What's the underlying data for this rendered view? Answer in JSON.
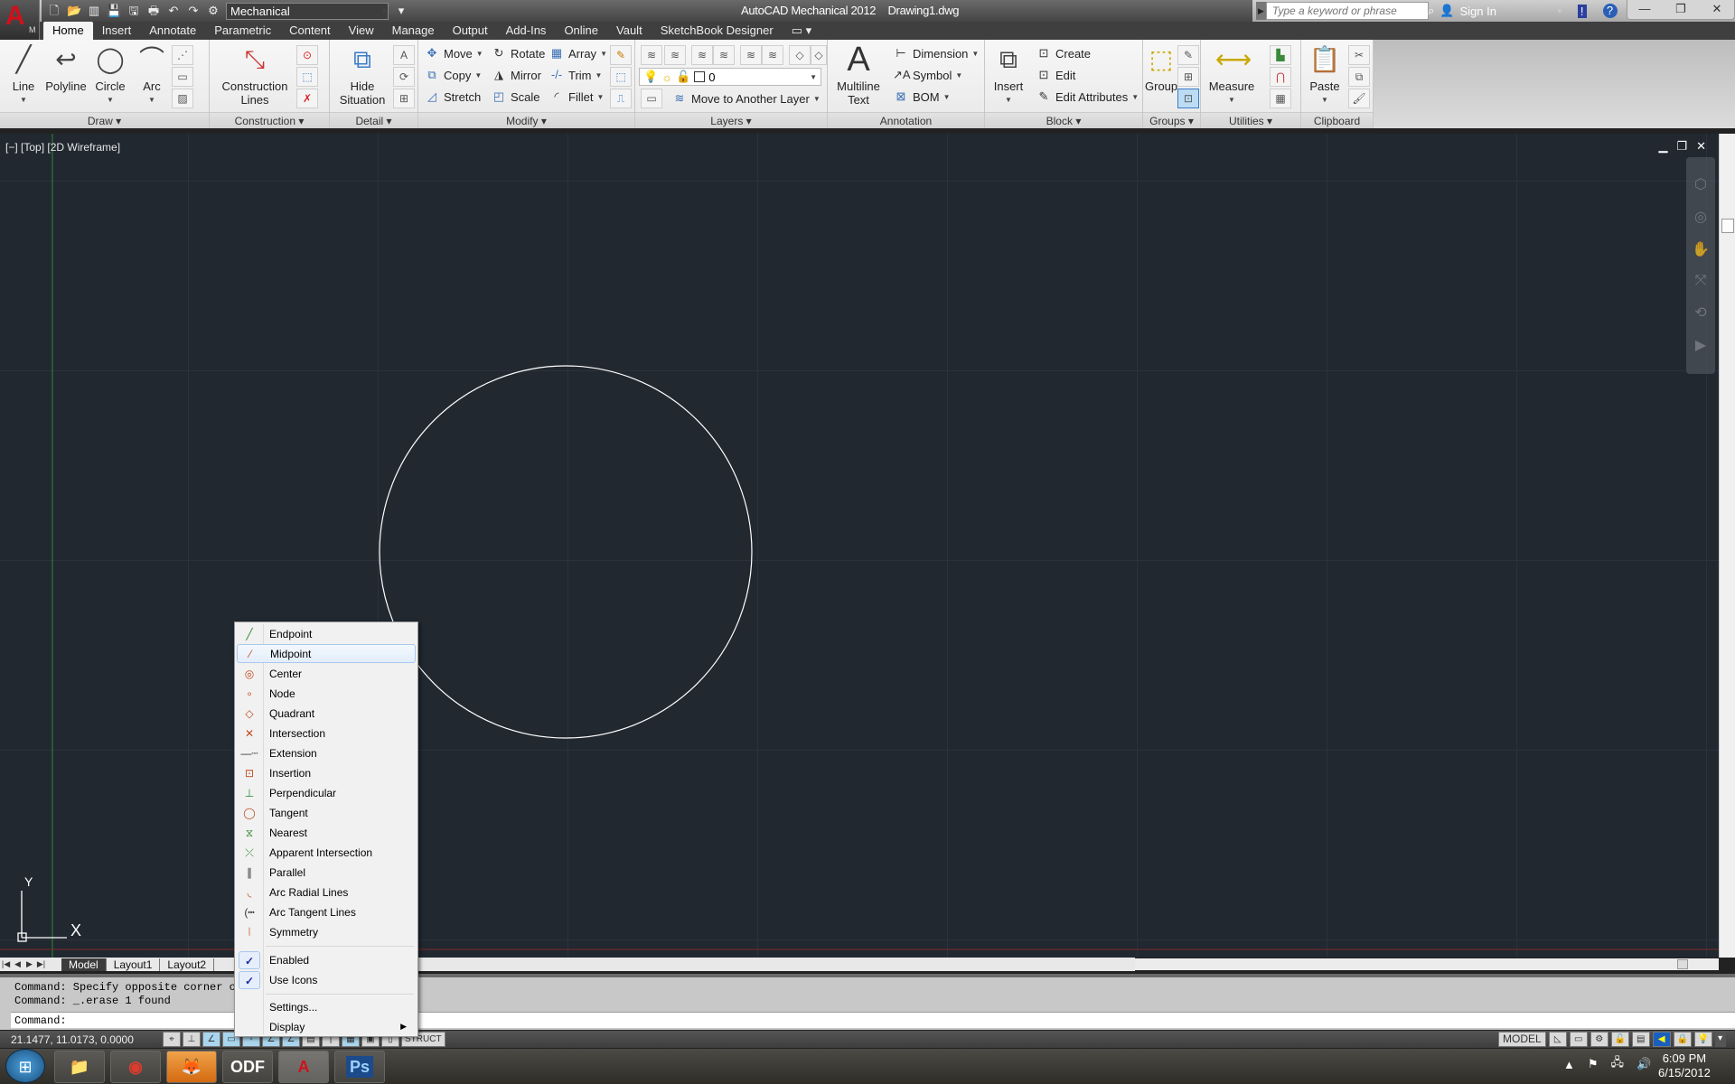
{
  "app": {
    "title": "AutoCAD Mechanical 2012",
    "document": "Drawing1.dwg",
    "workspace": "Mechanical",
    "logo_letter": "A",
    "logo_suffix": "M"
  },
  "quick_access": [
    "new-icon",
    "open-icon",
    "open-sheet-icon",
    "save-icon",
    "save-as-icon",
    "plot-icon",
    "undo-icon",
    "redo-icon",
    "workspace-switch-icon"
  ],
  "search": {
    "placeholder": "Type a keyword or phrase"
  },
  "account": {
    "sign_in": "Sign In"
  },
  "window_controls": {
    "minimize": "—",
    "restore": "❐",
    "close": "✕"
  },
  "tabs": [
    "Home",
    "Insert",
    "Annotate",
    "Parametric",
    "Content",
    "View",
    "Manage",
    "Output",
    "Add-Ins",
    "Online",
    "Vault",
    "SketchBook Designer"
  ],
  "active_tab": "Home",
  "ribbon": {
    "draw": {
      "title": "Draw",
      "line": "Line",
      "polyline": "Polyline",
      "circle": "Circle",
      "arc": "Arc"
    },
    "construction": {
      "title": "Construction",
      "lines1": "Construction",
      "lines2": "Lines"
    },
    "detail": {
      "title": "Detail",
      "hide1": "Hide",
      "hide2": "Situation"
    },
    "modify": {
      "title": "Modify",
      "move": "Move",
      "rotate": "Rotate",
      "array": "Array",
      "copy": "Copy",
      "mirror": "Mirror",
      "trim": "Trim",
      "stretch": "Stretch",
      "scale": "Scale",
      "fillet": "Fillet"
    },
    "layers": {
      "title": "Layers",
      "current_layer": "0",
      "move_layer": "Move to Another Layer"
    },
    "annotation": {
      "title": "Annotation",
      "mtext1": "Multiline",
      "mtext2": "Text",
      "dimension": "Dimension",
      "symbol": "Symbol",
      "bom": "BOM"
    },
    "block": {
      "title": "Block",
      "insert": "Insert",
      "create": "Create",
      "edit": "Edit",
      "edit_attributes": "Edit Attributes"
    },
    "groups": {
      "title": "Groups",
      "group": "Group"
    },
    "utilities": {
      "title": "Utilities",
      "measure": "Measure"
    },
    "clipboard": {
      "title": "Clipboard",
      "paste": "Paste"
    }
  },
  "viewport": {
    "label": "[−] [Top] [2D Wireframe]",
    "ucs_x": "X",
    "ucs_y": "Y",
    "colors": {
      "background": "#212830",
      "circle": "#ffffff",
      "y_axis": "#2f8a2f"
    }
  },
  "layout_tabs": [
    "Model",
    "Layout1",
    "Layout2"
  ],
  "active_layout": "Model",
  "command": {
    "history": [
      "Command: Specify opposite corner or",
      "Command: _.erase 1 found"
    ],
    "prompt": "Command:"
  },
  "status": {
    "coords": "21.1477, 11.0173, 0.0000",
    "struct_label": "STRUCT",
    "model_label": "MODEL"
  },
  "taskbar": {
    "apps": [
      "Windows Explorer",
      "Google Chrome",
      "Firefox",
      "ODF Document",
      "AutoCAD Mechanical",
      "Photoshop"
    ],
    "time": "6:09 PM",
    "date": "6/15/2012"
  },
  "osnap_menu": {
    "items": [
      {
        "label": "Endpoint",
        "icon": "endpoint-icon"
      },
      {
        "label": "Midpoint",
        "icon": "midpoint-icon",
        "highlighted": true
      },
      {
        "label": "Center",
        "icon": "center-icon"
      },
      {
        "label": "Node",
        "icon": "node-icon"
      },
      {
        "label": "Quadrant",
        "icon": "quadrant-icon"
      },
      {
        "label": "Intersection",
        "icon": "intersection-icon"
      },
      {
        "label": "Extension",
        "icon": "extension-icon"
      },
      {
        "label": "Insertion",
        "icon": "insertion-icon"
      },
      {
        "label": "Perpendicular",
        "icon": "perpendicular-icon"
      },
      {
        "label": "Tangent",
        "icon": "tangent-icon"
      },
      {
        "label": "Nearest",
        "icon": "nearest-icon"
      },
      {
        "label": "Apparent Intersection",
        "icon": "apparent-intersection-icon"
      },
      {
        "label": "Parallel",
        "icon": "parallel-icon"
      },
      {
        "label": "Arc Radial Lines",
        "icon": "arc-radial-lines-icon"
      },
      {
        "label": "Arc Tangent Lines",
        "icon": "arc-tangent-lines-icon"
      },
      {
        "label": "Symmetry",
        "icon": "symmetry-icon"
      }
    ],
    "enabled": {
      "label": "Enabled",
      "checked": true
    },
    "use_icons": {
      "label": "Use Icons",
      "checked": true
    },
    "settings": "Settings...",
    "display": "Display"
  }
}
